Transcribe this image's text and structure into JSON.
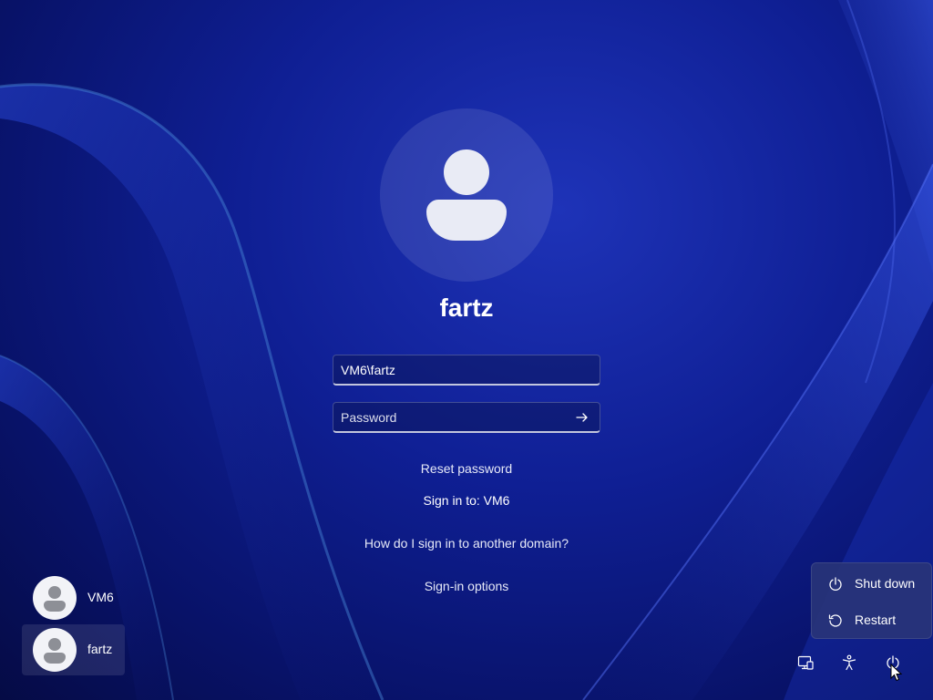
{
  "user": {
    "display_name": "fartz"
  },
  "form": {
    "username_value": "VM6\\fartz",
    "password_placeholder": "Password"
  },
  "links": {
    "reset_password": "Reset password",
    "sign_in_to": "Sign in to: VM6",
    "other_domain": "How do I sign in to another domain?",
    "sign_in_options": "Sign-in options"
  },
  "user_tiles": [
    {
      "label": "VM6",
      "selected": false
    },
    {
      "label": "fartz",
      "selected": true
    }
  ],
  "power_menu": {
    "items": [
      {
        "label": "Shut down",
        "icon": "power-icon"
      },
      {
        "label": "Restart",
        "icon": "restart-icon"
      }
    ]
  },
  "tray_icons": [
    "network-icon",
    "accessibility-icon",
    "power-icon"
  ],
  "colors": {
    "accent": "#1a2fb0",
    "background": "#0f1f94"
  }
}
